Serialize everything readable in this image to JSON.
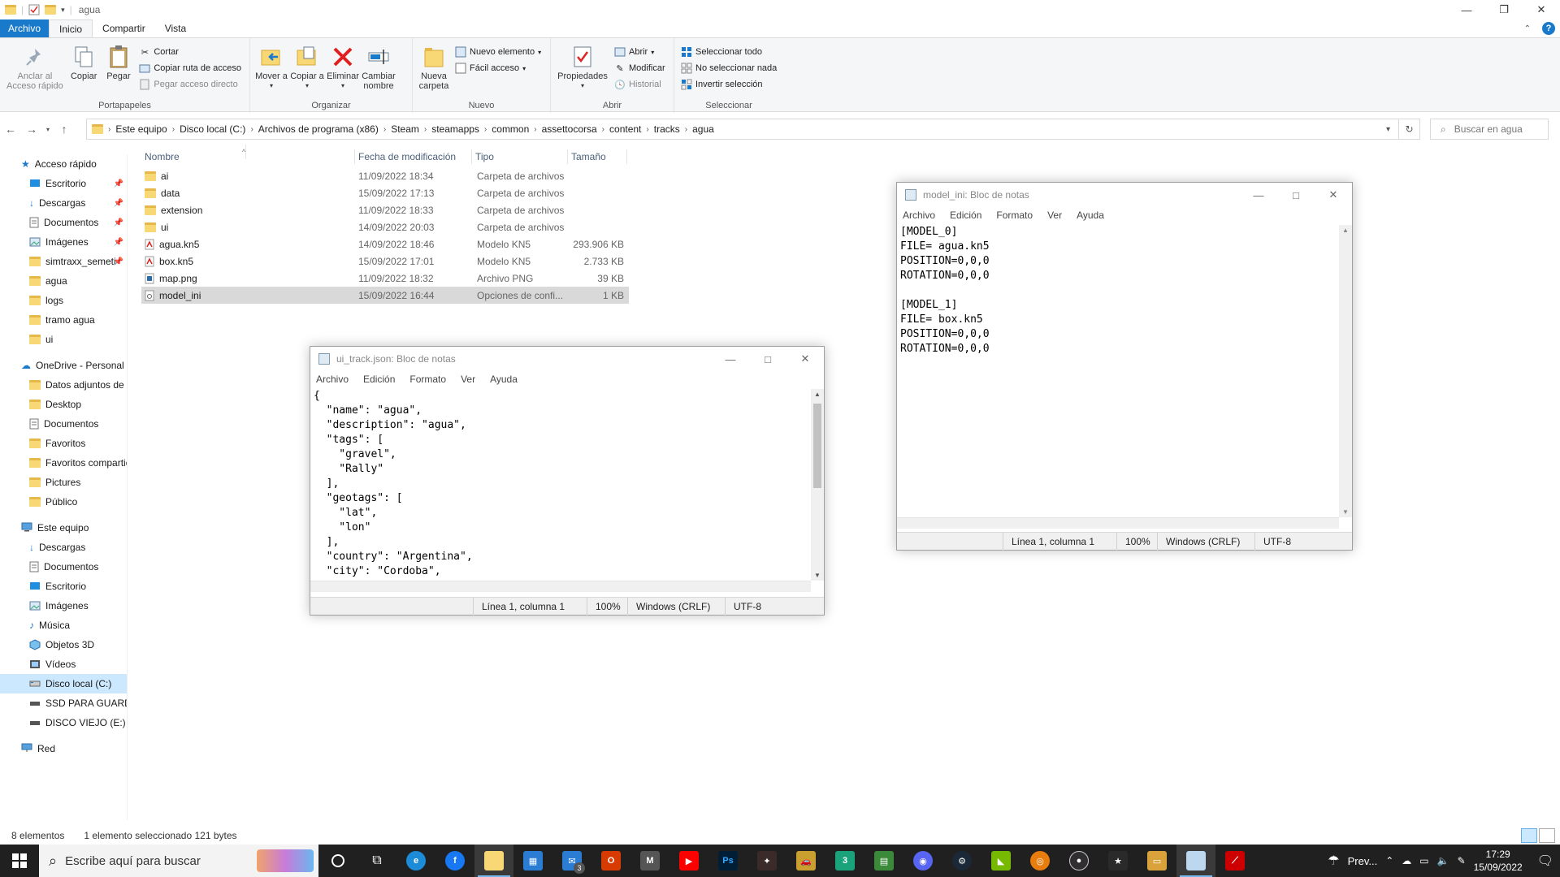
{
  "explorer": {
    "window_title": "agua",
    "tabs": {
      "file": "Archivo",
      "home": "Inicio",
      "share": "Compartir",
      "view": "Vista"
    },
    "ribbon": {
      "portapapeles": {
        "label": "Portapapeles",
        "pin": "Anclar al Acceso rápido",
        "copy": "Copiar",
        "paste": "Pegar",
        "cut": "Cortar",
        "copy_path": "Copiar ruta de acceso",
        "paste_shortcut": "Pegar acceso directo"
      },
      "organizar": {
        "label": "Organizar",
        "move": "Mover a",
        "copyto": "Copiar a",
        "delete": "Eliminar",
        "rename": "Cambiar nombre"
      },
      "nuevo": {
        "label": "Nuevo",
        "new_folder": "Nueva carpeta",
        "new_item": "Nuevo elemento",
        "easy_access": "Fácil acceso"
      },
      "abrir": {
        "label": "Abrir",
        "properties": "Propiedades",
        "open": "Abrir",
        "edit": "Modificar",
        "history": "Historial"
      },
      "seleccionar": {
        "label": "Seleccionar",
        "select_all": "Seleccionar todo",
        "select_none": "No seleccionar nada",
        "invert": "Invertir selección"
      }
    },
    "breadcrumb": [
      "Este equipo",
      "Disco local (C:)",
      "Archivos de programa (x86)",
      "Steam",
      "steamapps",
      "common",
      "assettocorsa",
      "content",
      "tracks",
      "agua"
    ],
    "search_placeholder": "Buscar en agua",
    "nav": {
      "quick_access": "Acceso rápido",
      "quick_items": [
        "Escritorio",
        "Descargas",
        "Documentos",
        "Imágenes",
        "simtraxx_semeti",
        "agua",
        "logs",
        "tramo agua",
        "ui"
      ],
      "onedrive": "OneDrive - Personal",
      "onedrive_items": [
        "Datos adjuntos de c",
        "Desktop",
        "Documentos",
        "Favoritos",
        "Favoritos compartic",
        "Pictures",
        "Público"
      ],
      "this_pc": "Este equipo",
      "pc_items": [
        "Descargas",
        "Documentos",
        "Escritorio",
        "Imágenes",
        "Música",
        "Objetos 3D",
        "Vídeos",
        "Disco local (C:)",
        "SSD PARA GUARDA",
        "DISCO VIEJO (E:)"
      ],
      "network": "Red"
    },
    "columns": {
      "name": "Nombre",
      "date": "Fecha de modificación",
      "type": "Tipo",
      "size": "Tamaño"
    },
    "files": [
      {
        "name": "ai",
        "date": "11/09/2022 18:34",
        "type": "Carpeta de archivos",
        "size": ""
      },
      {
        "name": "data",
        "date": "15/09/2022 17:13",
        "type": "Carpeta de archivos",
        "size": ""
      },
      {
        "name": "extension",
        "date": "11/09/2022 18:33",
        "type": "Carpeta de archivos",
        "size": ""
      },
      {
        "name": "ui",
        "date": "14/09/2022 20:03",
        "type": "Carpeta de archivos",
        "size": ""
      },
      {
        "name": "agua.kn5",
        "date": "14/09/2022 18:46",
        "type": "Modelo KN5",
        "size": "293.906 KB"
      },
      {
        "name": "box.kn5",
        "date": "15/09/2022 17:01",
        "type": "Modelo KN5",
        "size": "2.733 KB"
      },
      {
        "name": "map.png",
        "date": "11/09/2022 18:32",
        "type": "Archivo PNG",
        "size": "39 KB"
      },
      {
        "name": "model_ini",
        "date": "15/09/2022 16:44",
        "type": "Opciones de confi...",
        "size": "1 KB"
      }
    ],
    "status": {
      "count": "8 elementos",
      "selected": "1 elemento seleccionado  121 bytes"
    }
  },
  "notepad_json": {
    "title": "ui_track.json: Bloc de notas",
    "menu": [
      "Archivo",
      "Edición",
      "Formato",
      "Ver",
      "Ayuda"
    ],
    "content": "{\n  \"name\": \"agua\",\n  \"description\": \"agua\",\n  \"tags\": [\n    \"gravel\",\n    \"Rally\"\n  ],\n  \"geotags\": [\n    \"lat\",\n    \"lon\"\n  ],\n  \"country\": \"Argentina\",\n  \"city\": \"Cordoba\",",
    "status": {
      "pos": "Línea 1, columna 1",
      "zoom": "100%",
      "eol": "Windows (CRLF)",
      "enc": "UTF-8"
    }
  },
  "notepad_ini": {
    "title": "model_ini: Bloc de notas",
    "menu": [
      "Archivo",
      "Edición",
      "Formato",
      "Ver",
      "Ayuda"
    ],
    "content": "[MODEL_0]\nFILE= agua.kn5\nPOSITION=0,0,0\nROTATION=0,0,0\n\n[MODEL_1]\nFILE= box.kn5\nPOSITION=0,0,0\nROTATION=0,0,0",
    "status": {
      "pos": "Línea 1, columna 1",
      "zoom": "100%",
      "eol": "Windows (CRLF)",
      "enc": "UTF-8"
    }
  },
  "taskbar": {
    "search_placeholder": "Escribe aquí para buscar",
    "weather": "Prev...",
    "time": "17:29",
    "date": "15/09/2022",
    "mail_badge": "3"
  }
}
